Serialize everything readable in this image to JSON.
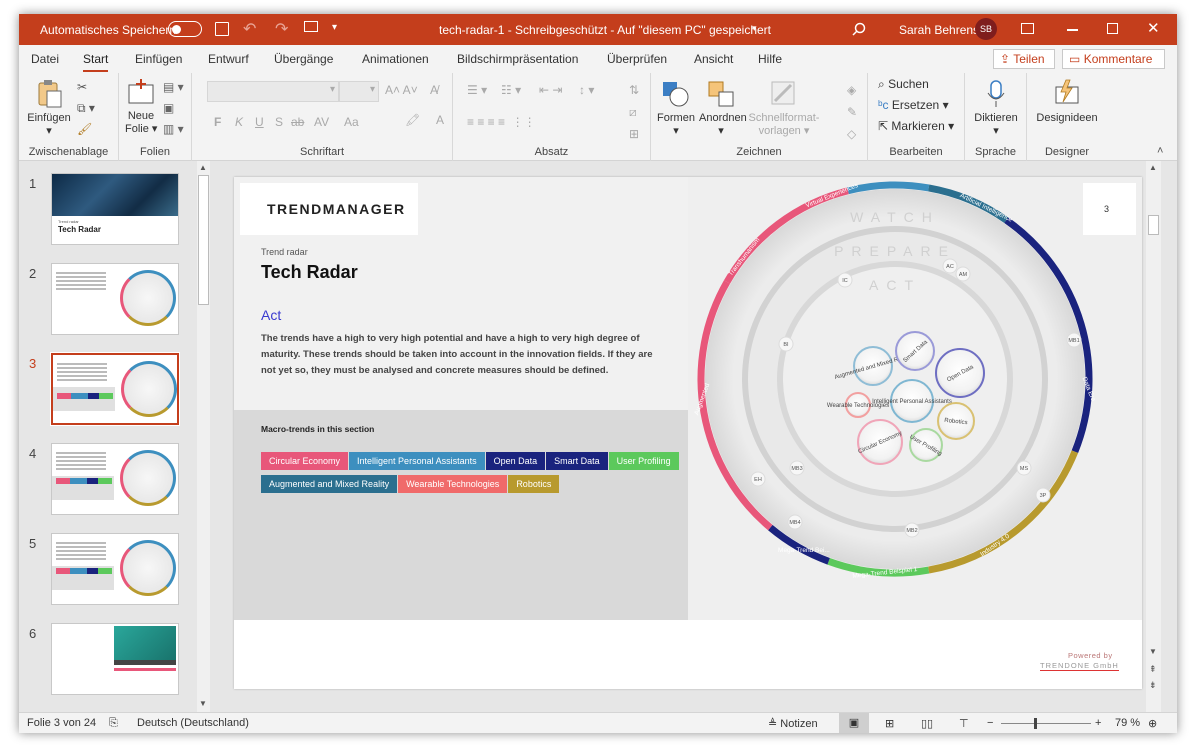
{
  "window": {
    "autosave_label": "Automatisches Speichern",
    "title": "tech-radar-1  -  Schreibgeschützt  -  Auf \"diesem PC\" gespeichert",
    "user_name": "Sarah Behrens",
    "user_initials": "SB"
  },
  "tabs": [
    "Datei",
    "Start",
    "Einfügen",
    "Entwurf",
    "Übergänge",
    "Animationen",
    "Bildschirmpräsentation",
    "Überprüfen",
    "Ansicht",
    "Hilfe"
  ],
  "share_label": "Teilen",
  "comments_label": "Kommentare",
  "ribbon": {
    "clipboard": {
      "paste": "Einfügen",
      "group": "Zwischenablage"
    },
    "slides": {
      "new_slide_line1": "Neue",
      "new_slide_line2": "Folie",
      "group": "Folien"
    },
    "font": {
      "group": "Schriftart",
      "bold": "F",
      "italic": "K",
      "underline": "U",
      "shadow": "S",
      "strike": "ab",
      "spacing": "AV",
      "case": "Aa"
    },
    "paragraph": {
      "group": "Absatz"
    },
    "drawing": {
      "shapes": "Formen",
      "arrange": "Anordnen",
      "quick_styles_line1": "Schnellformat-",
      "quick_styles_line2": "vorlagen",
      "group": "Zeichnen"
    },
    "editing": {
      "find": "Suchen",
      "replace": "Ersetzen",
      "select": "Markieren",
      "group": "Bearbeiten"
    },
    "voice": {
      "dictate": "Diktieren",
      "group": "Sprache"
    },
    "designer": {
      "ideas": "Designideen",
      "group": "Designer"
    }
  },
  "thumbnails": [
    {
      "num": "1",
      "title": "Tech Radar",
      "kicker": "Trend radar"
    },
    {
      "num": "2"
    },
    {
      "num": "3"
    },
    {
      "num": "4"
    },
    {
      "num": "5"
    },
    {
      "num": "6"
    }
  ],
  "slide": {
    "logo": "TRENDMANAGER",
    "page_number": "3",
    "kicker": "Trend radar",
    "title": "Tech Radar",
    "section": "Act",
    "body": "The trends have a high to very high potential and have a high to very high degree of maturity. These trends should be taken into account in the innovation fields. If they are not yet so, they must be analysed and concrete measures should be defined.",
    "macro_heading": "Macro-trends in this section",
    "chips": [
      {
        "label": "Circular Economy",
        "color": "#e8577a"
      },
      {
        "label": "Intelligent Personal Assistants",
        "color": "#3d8fbf"
      },
      {
        "label": "Open Data",
        "color": "#1a237e"
      },
      {
        "label": "Smart Data",
        "color": "#1a237e"
      },
      {
        "label": "User Profiling",
        "color": "#5cc95c"
      },
      {
        "label": "Augmented and Mixed Reality",
        "color": "#2b6f8f"
      },
      {
        "label": "Wearable Technologies",
        "color": "#f06a6a"
      },
      {
        "label": "Robotics",
        "color": "#b89a2e"
      }
    ],
    "ring_labels": {
      "watch": "WATCH",
      "prepare": "PREPARE",
      "act": "ACT"
    },
    "segments": [
      "Virtual Experiences",
      "Artificial Intelligence",
      "Data Era",
      "Industry 4.0",
      "Mega-Trend Beispiel 1",
      "Mega-Trend Bei...",
      "Augmented",
      "Transhumanism"
    ],
    "bubbles": [
      "Augmented and Mixed Reality",
      "Smart Data",
      "Open Data",
      "Intelligent Personal Assistants",
      "Wearable Technologies",
      "Robotics",
      "Circular Economy",
      "User Profiling"
    ],
    "markers": [
      "AC",
      "AM",
      "IC",
      "BI",
      "MB1",
      "EH",
      "MB3",
      "MB4",
      "MB2",
      "MS",
      "3P"
    ],
    "powered_line1": "Powered by",
    "powered_line2": "TRENDONE GmbH"
  },
  "status": {
    "slide_info": "Folie 3 von 24",
    "language": "Deutsch (Deutschland)",
    "notes": "Notizen",
    "zoom": "79 %"
  },
  "colors": {
    "accent": "#c43e1c"
  }
}
